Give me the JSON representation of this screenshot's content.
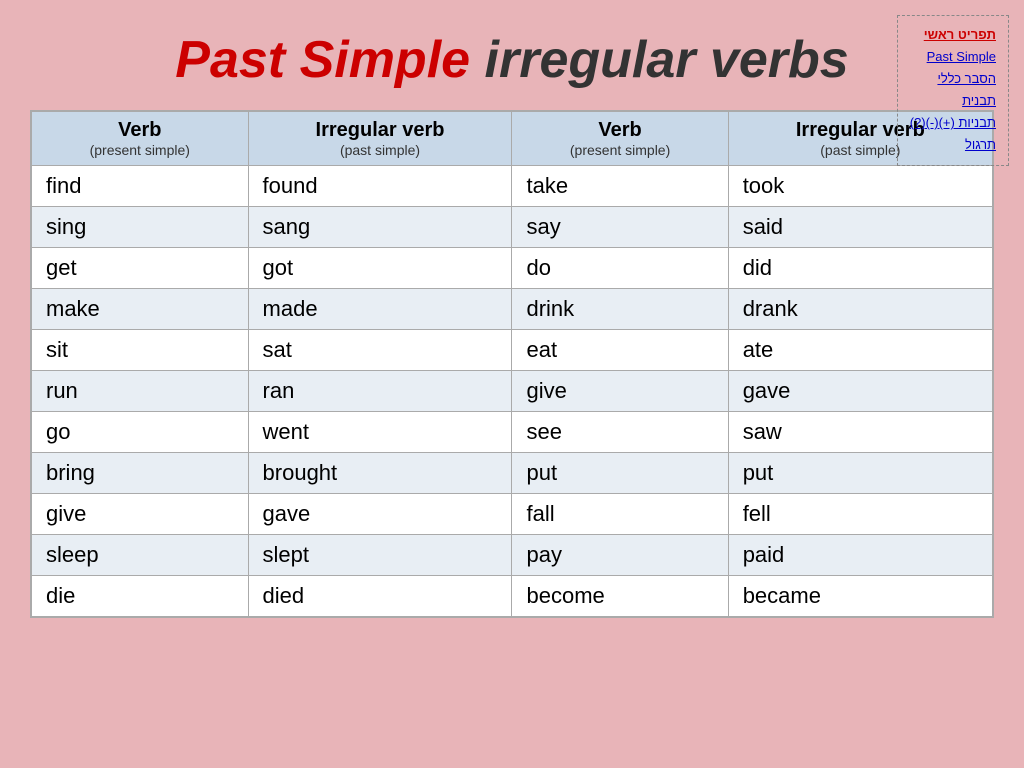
{
  "title": {
    "part1": "Past Simple",
    "part2": "irregular verbs"
  },
  "nav": {
    "items": [
      {
        "label": "תפריט ראשי",
        "active": true
      },
      {
        "label": "Past Simple",
        "active": false
      },
      {
        "label": "הסבר כללי",
        "active": false
      },
      {
        "label": "תבנית",
        "active": false
      },
      {
        "label": "תבניות (+)(-)(?)",
        "active": false
      },
      {
        "label": "תרגול",
        "active": false
      }
    ]
  },
  "table": {
    "headers": [
      {
        "main": "Verb",
        "sub": "(present simple)"
      },
      {
        "main": "Irregular verb",
        "sub": "(past simple)"
      },
      {
        "main": "Verb",
        "sub": "(present simple)"
      },
      {
        "main": "Irregular verb",
        "sub": "(past simple)"
      }
    ],
    "rows": [
      [
        "find",
        "found",
        "take",
        "took"
      ],
      [
        "sing",
        "sang",
        "say",
        "said"
      ],
      [
        "get",
        "got",
        "do",
        "did"
      ],
      [
        "make",
        "made",
        "drink",
        "drank"
      ],
      [
        "sit",
        "sat",
        "eat",
        "ate"
      ],
      [
        "run",
        "ran",
        "give",
        "gave"
      ],
      [
        "go",
        "went",
        "see",
        "saw"
      ],
      [
        "bring",
        "brought",
        "put",
        "put"
      ],
      [
        "give",
        "gave",
        "fall",
        "fell"
      ],
      [
        "sleep",
        "slept",
        "pay",
        "paid"
      ],
      [
        "die",
        "died",
        "become",
        "became"
      ]
    ]
  }
}
